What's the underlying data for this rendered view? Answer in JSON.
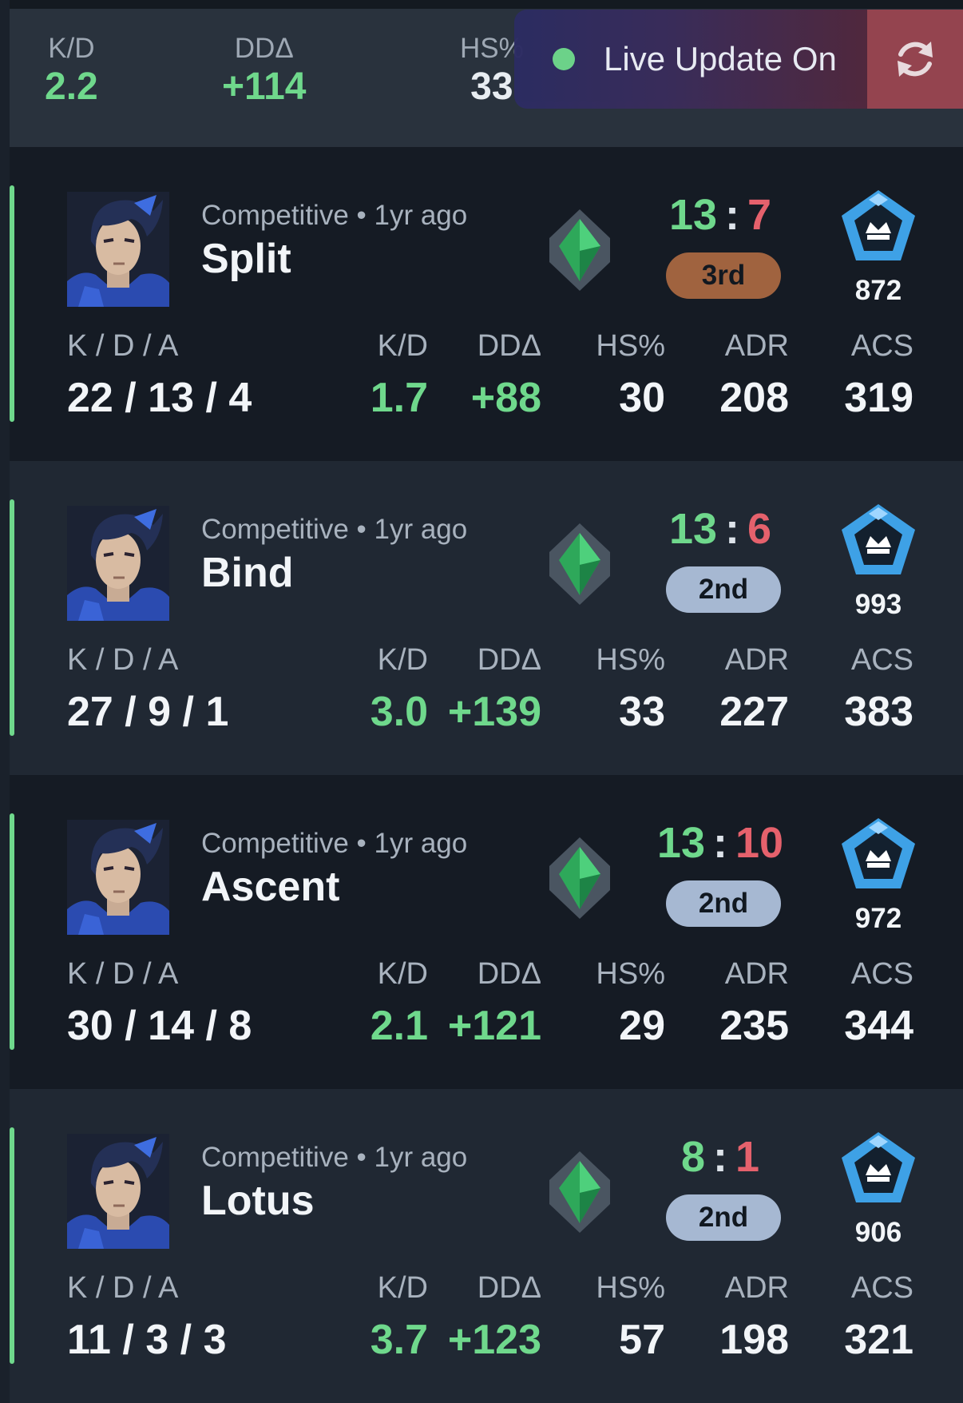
{
  "summary": {
    "stats": [
      {
        "label": "K/D",
        "value": "2.2"
      },
      {
        "label": "DDΔ",
        "value": "+114"
      },
      {
        "label": "HS%",
        "value": "33"
      }
    ]
  },
  "live_update": {
    "label": "Live Update On"
  },
  "stat_labels": {
    "kda": "K / D / A",
    "kd": "K/D",
    "dd": "DDΔ",
    "hs": "HS%",
    "adr": "ADR",
    "acs": "ACS"
  },
  "matches": [
    {
      "mode": "Competitive • 1yr ago",
      "map": "Split",
      "score_won": "13",
      "score_sep": ":",
      "score_lost": "7",
      "placement": "3rd",
      "rank_points": "872",
      "kda": "22 / 13 / 4",
      "kd": "1.7",
      "dd": "+88",
      "hs": "30",
      "adr": "208",
      "acs": "319"
    },
    {
      "mode": "Competitive • 1yr ago",
      "map": "Bind",
      "score_won": "13",
      "score_sep": ":",
      "score_lost": "6",
      "placement": "2nd",
      "rank_points": "993",
      "kda": "27 / 9 / 1",
      "kd": "3.0",
      "dd": "+139",
      "hs": "33",
      "adr": "227",
      "acs": "383"
    },
    {
      "mode": "Competitive • 1yr ago",
      "map": "Ascent",
      "score_won": "13",
      "score_sep": ":",
      "score_lost": "10",
      "placement": "2nd",
      "rank_points": "972",
      "kda": "30 / 14 / 8",
      "kd": "2.1",
      "dd": "+121",
      "hs": "29",
      "adr": "235",
      "acs": "344"
    },
    {
      "mode": "Competitive • 1yr ago",
      "map": "Lotus",
      "score_won": "8",
      "score_sep": ":",
      "score_lost": "1",
      "placement": "2nd",
      "rank_points": "906",
      "kda": "11 / 3 / 3",
      "kd": "3.7",
      "dd": "+123",
      "hs": "57",
      "adr": "198",
      "acs": "321"
    }
  ],
  "colors": {
    "positive": "#6fd88c",
    "negative": "#e5616c",
    "placement_bronze": "#a0633f",
    "placement_silver": "#a6b8d2"
  },
  "icons": {
    "agent": "agent-portrait-icon",
    "rank": "green-diamond-rank-icon",
    "emblem": "blue-pentagon-crown-icon",
    "refresh": "refresh-icon"
  }
}
